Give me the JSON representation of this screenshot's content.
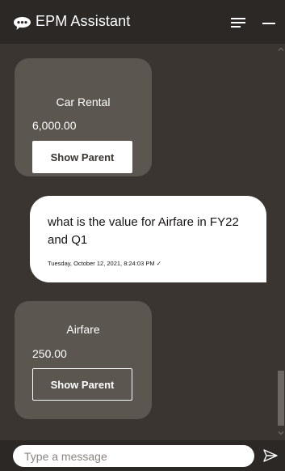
{
  "header": {
    "title": "EPM Assistant",
    "logo_icon": "chat-bubble-icon",
    "menu_icon": "hamburger-menu-icon",
    "minimize_icon": "minimize-icon"
  },
  "messages": {
    "bot_1": {
      "title": "Car Rental",
      "value": "6,000.00",
      "button_label": "Show Parent"
    },
    "user_1": {
      "text": "what is the value for Airfare in FY22 and Q1",
      "timestamp": "Tuesday, October 12, 2021, 8:24:03 PM ✓"
    },
    "bot_2": {
      "title": "Airfare",
      "value": "250.00",
      "button_label": "Show Parent"
    }
  },
  "composer": {
    "placeholder": "Type a message",
    "send_icon": "send-icon"
  },
  "colors": {
    "header_bg": "#2b2826",
    "conversation_bg": "#3a3530",
    "bot_card_bg": "#5c5651",
    "user_bubble_bg": "#ffffff"
  }
}
